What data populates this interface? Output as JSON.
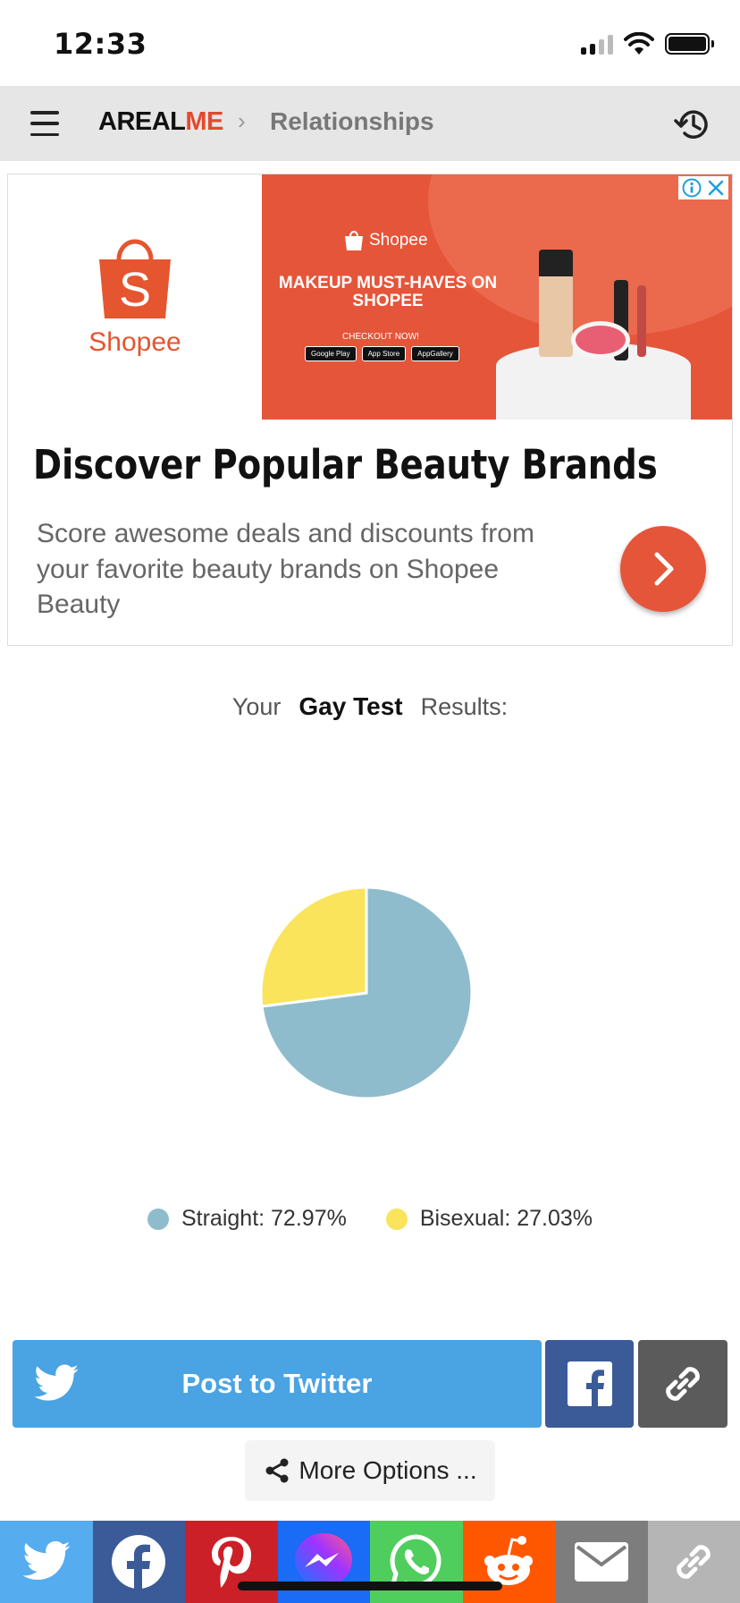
{
  "status_bar": {
    "time": "12:33"
  },
  "nav": {
    "brand_part1": "AREAL",
    "brand_part2": "ME",
    "breadcrumb_sep": "›",
    "breadcrumb": "Relationships"
  },
  "ad": {
    "logo_text": "Shopee",
    "banner_brand": "Shopee",
    "banner_headline": "MAKEUP MUST-HAVES ON SHOPEE",
    "banner_cta": "CHECKOUT NOW!",
    "stores": [
      "Google Play",
      "App Store",
      "AppGallery"
    ],
    "title": "Discover Popular Beauty Brands",
    "description": "Score awesome deals and discounts from your favorite beauty brands on Shopee Beauty"
  },
  "results": {
    "prefix": "Your",
    "test_name": "Gay Test",
    "suffix": "Results:"
  },
  "chart_data": {
    "type": "pie",
    "categories": [
      "Straight",
      "Bisexual"
    ],
    "values": [
      72.97,
      27.03
    ],
    "colors": [
      "#8fbccc",
      "#f9e45b"
    ],
    "legend_labels": [
      "Straight: 72.97%",
      "Bisexual: 27.03%"
    ],
    "legend_position": "bottom"
  },
  "share": {
    "twitter_label": "Post to Twitter",
    "more_options": "More Options ..."
  },
  "share_bar": {
    "colors": [
      "#55acee",
      "#3b5a98",
      "#cb2027",
      "#1a6bf5",
      "#4fce5d",
      "#ff5700",
      "#7d7d7d",
      "#b5b5b5"
    ],
    "icons": [
      "twitter-icon",
      "facebook-icon",
      "pinterest-icon",
      "messenger-icon",
      "whatsapp-icon",
      "reddit-icon",
      "email-icon",
      "link-icon"
    ]
  }
}
